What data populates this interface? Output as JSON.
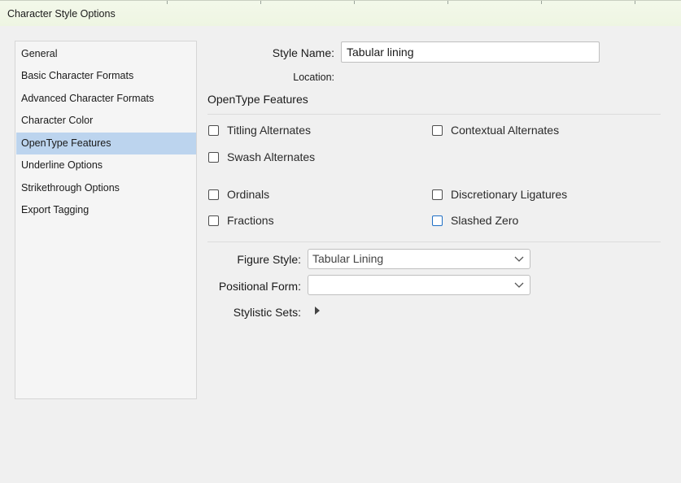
{
  "window": {
    "title": "Character Style Options"
  },
  "sidebar": {
    "items": [
      {
        "label": "General"
      },
      {
        "label": "Basic Character Formats"
      },
      {
        "label": "Advanced Character Formats"
      },
      {
        "label": "Character Color"
      },
      {
        "label": "OpenType Features"
      },
      {
        "label": "Underline Options"
      },
      {
        "label": "Strikethrough Options"
      },
      {
        "label": "Export Tagging"
      }
    ],
    "selected": "OpenType Features"
  },
  "form": {
    "style_name_label": "Style Name:",
    "style_name_value": "Tabular lining",
    "location_label": "Location:",
    "section_title": "OpenType Features",
    "checkboxes": [
      {
        "label": "Titling Alternates",
        "checked": false
      },
      {
        "label": "Contextual Alternates",
        "checked": false
      },
      {
        "label": "Swash Alternates",
        "checked": false
      },
      {
        "label": "Ordinals",
        "checked": false
      },
      {
        "label": "Discretionary Ligatures",
        "checked": false
      },
      {
        "label": "Fractions",
        "checked": false
      },
      {
        "label": "Slashed Zero",
        "checked": false
      }
    ],
    "figure_style_label": "Figure Style:",
    "figure_style_value": "Tabular Lining",
    "positional_form_label": "Positional Form:",
    "positional_form_value": "",
    "stylistic_sets_label": "Stylistic Sets:"
  },
  "icons": {
    "dropdown": "chevron-down-icon",
    "expand": "triangle-right-icon"
  },
  "colors": {
    "selection": "#bcd4ee",
    "focus": "#1f6fc5"
  }
}
